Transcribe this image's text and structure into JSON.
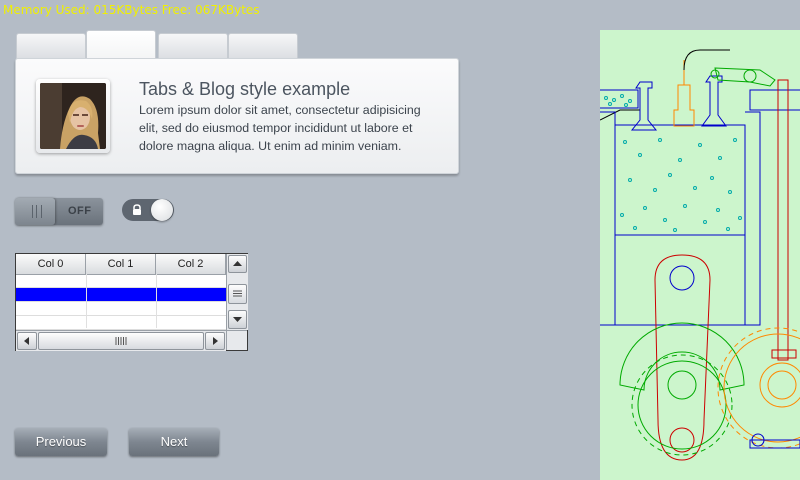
{
  "status": {
    "memory_text": "Memory Used: 015KBytes Free: 067KBytes"
  },
  "tabs": [
    {
      "label": "",
      "active": false
    },
    {
      "label": "",
      "active": true
    },
    {
      "label": "",
      "active": false
    },
    {
      "label": "",
      "active": false
    }
  ],
  "blog": {
    "title": "Tabs & Blog style example",
    "body": "Lorem ipsum dolor sit amet, consectetur adipisicing elit, sed do eiusmod tempor incididunt ut labore et dolore magna aliqua. Ut enim ad minim veniam."
  },
  "toggle": {
    "state_label": "OFF"
  },
  "lock_switch": {
    "icon": "lock-icon"
  },
  "table": {
    "columns": [
      "Col 0",
      "Col 1",
      "Col 2"
    ],
    "selected_row": 1
  },
  "buttons": {
    "previous": "Previous",
    "next": "Next"
  },
  "colors": {
    "status_text": "#f0f000",
    "selection": "#0000ff",
    "engine_bg": "#ccf5cc"
  }
}
